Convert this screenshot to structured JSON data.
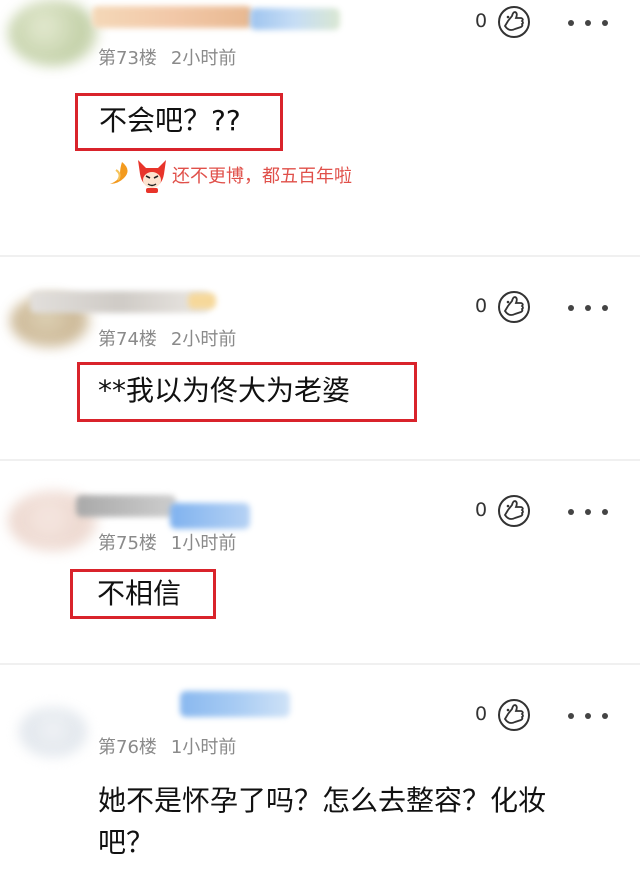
{
  "comments": [
    {
      "floor": "第73楼",
      "time": "2小时前",
      "likes": "0",
      "text": "不会吧？??",
      "reply": "还不更博，都五百年啦"
    },
    {
      "floor": "第74楼",
      "time": "2小时前",
      "likes": "0",
      "text": "**我以为佟大为老婆"
    },
    {
      "floor": "第75楼",
      "time": "1小时前",
      "likes": "0",
      "text": "不相信"
    },
    {
      "floor": "第76楼",
      "time": "1小时前",
      "likes": "0",
      "text_line1": "她不是怀孕了吗？怎么去整容？化妆",
      "text_line2": "吧？"
    }
  ],
  "icons": {
    "like": "thumbs-up-face-icon",
    "more": "more-dots-icon",
    "reply_emoji": "fox-emoji-icon",
    "reply_arrow": "reply-swirl-icon"
  },
  "colors": {
    "highlight_box": "#d9232b",
    "reply_text": "#e0504a",
    "meta_text": "#8a8a8a"
  }
}
